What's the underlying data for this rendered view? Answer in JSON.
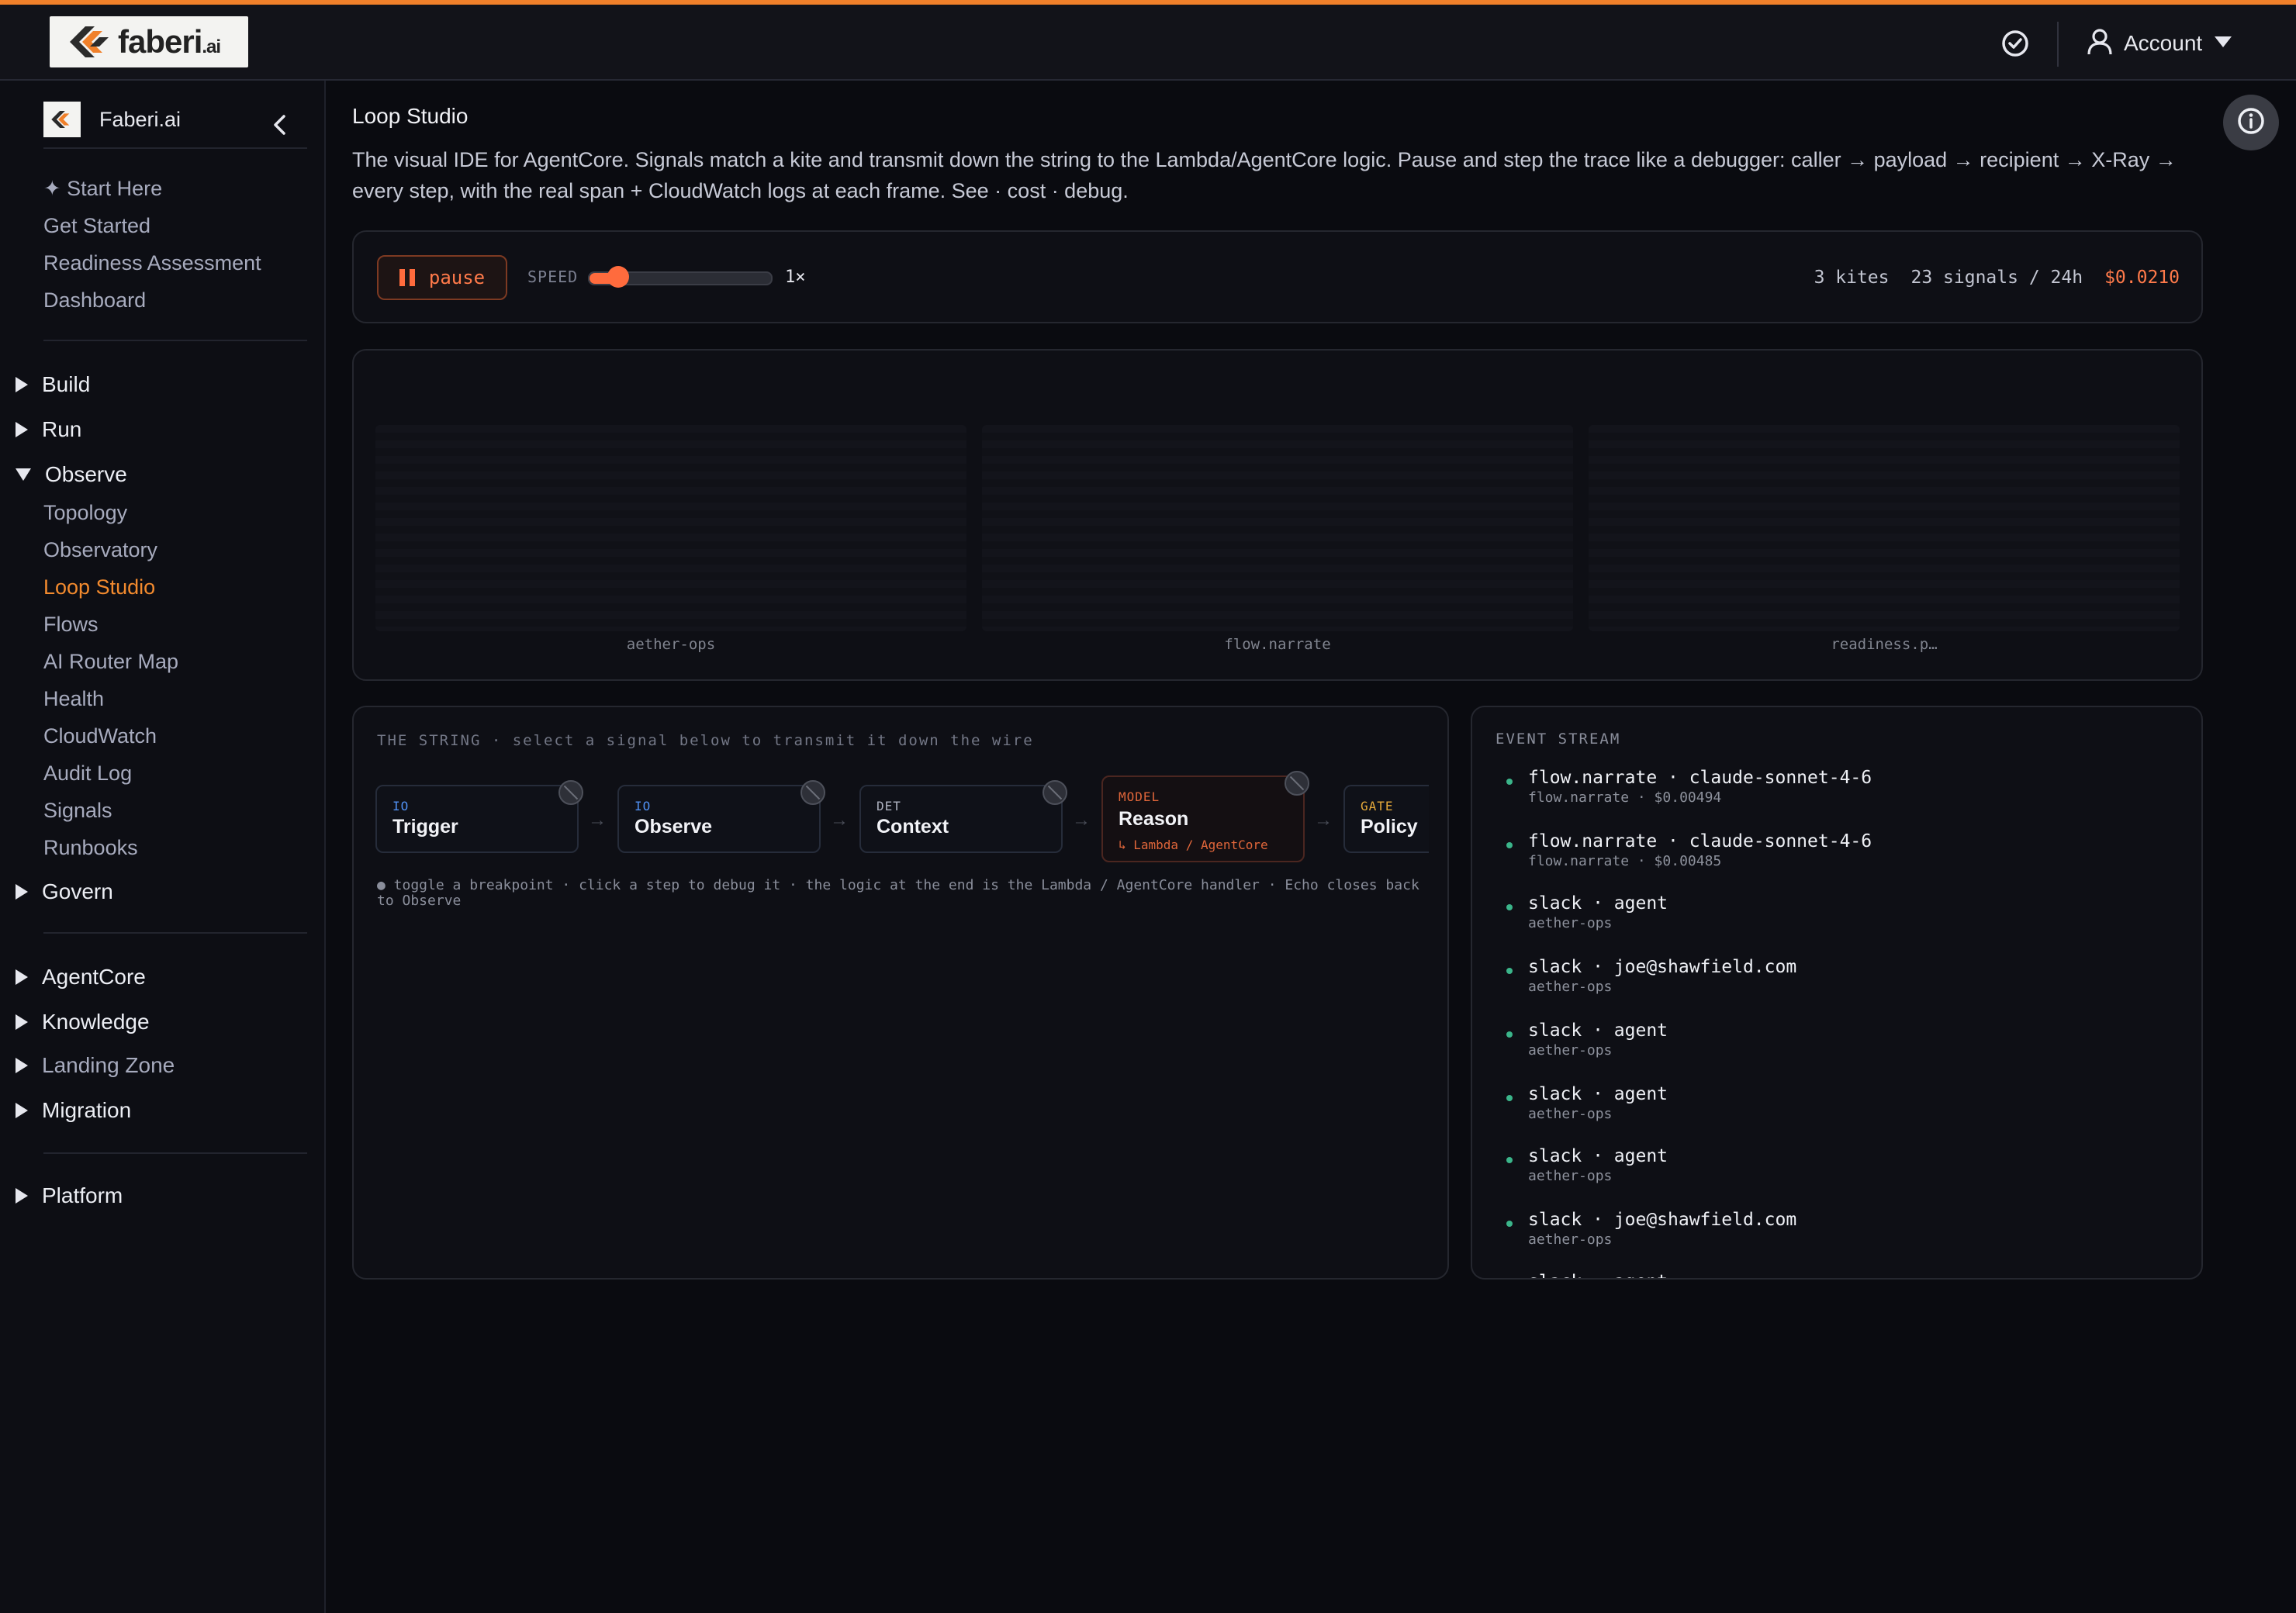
{
  "brand": {
    "logo_word": "faberi",
    "logo_suffix": ".ai",
    "accent": "#f0802a"
  },
  "topbar": {
    "account_label": "Account",
    "check_icon": "check-circle-icon",
    "user_icon": "user-icon"
  },
  "sidebar": {
    "org_name": "Faberi.ai",
    "links_top": [
      "✦ Start Here",
      "Get Started",
      "Readiness Assessment",
      "Dashboard"
    ],
    "groups": {
      "build": "Build",
      "run": "Run",
      "observe": "Observe",
      "govern": "Govern",
      "agentcore": "AgentCore",
      "knowledge": "Knowledge",
      "landing_zone": "Landing Zone",
      "migration": "Migration",
      "platform": "Platform"
    },
    "observe_items": [
      "Topology",
      "Observatory",
      "Loop Studio",
      "Flows",
      "AI Router Map",
      "Health",
      "CloudWatch",
      "Audit Log",
      "Signals",
      "Runbooks"
    ],
    "active_item": "Loop Studio"
  },
  "main": {
    "title": "Loop Studio",
    "description": "The visual IDE for AgentCore. Signals match a kite and transmit down the string to the Lambda/AgentCore logic. Pause and step the trace like a debugger: caller → payload → recipient → X-Ray → every step, with the real span + CloudWatch logs at each frame. See · cost · debug."
  },
  "controls": {
    "pause_label": "pause",
    "speed_label": "SPEED",
    "speed_value": "1×",
    "speed_fraction": 0.15,
    "kites": "3 kites",
    "signals": "23 signals / 24h",
    "cost": "$0.0210"
  },
  "kites": [
    "aether-ops",
    "flow.narrate",
    "readiness.p…"
  ],
  "string": {
    "title": "THE STRING · select a signal below to transmit it down the wire",
    "steps": [
      {
        "tag": "IO",
        "name": "Trigger",
        "tag_color": "#4f8ff0"
      },
      {
        "tag": "IO",
        "name": "Observe",
        "tag_color": "#4f8ff0"
      },
      {
        "tag": "DET",
        "name": "Context",
        "tag_color": "#aeb2c0"
      },
      {
        "tag": "MODEL",
        "name": "Reason",
        "tag_color": "#e0663a",
        "sub": "↳ Lambda / AgentCore"
      },
      {
        "tag": "GATE",
        "name": "Policy",
        "tag_color": "#e5a93a"
      }
    ],
    "hint": "● toggle a breakpoint · click a step to debug it · the logic at the end is the Lambda / AgentCore handler · Echo closes back to Observe"
  },
  "events": {
    "title": "EVENT STREAM",
    "items": [
      {
        "main": "flow.narrate · claude-sonnet-4-6",
        "meta": "flow.narrate · $0.00494"
      },
      {
        "main": "flow.narrate · claude-sonnet-4-6",
        "meta": "flow.narrate · $0.00485"
      },
      {
        "main": "slack · agent",
        "meta": "aether-ops"
      },
      {
        "main": "slack · joe@shawfield.com",
        "meta": "aether-ops"
      },
      {
        "main": "slack · agent",
        "meta": "aether-ops"
      },
      {
        "main": "slack · agent",
        "meta": "aether-ops"
      },
      {
        "main": "slack · agent",
        "meta": "aether-ops"
      },
      {
        "main": "slack · joe@shawfield.com",
        "meta": "aether-ops"
      },
      {
        "main": "slack · agent",
        "meta": ""
      }
    ]
  }
}
